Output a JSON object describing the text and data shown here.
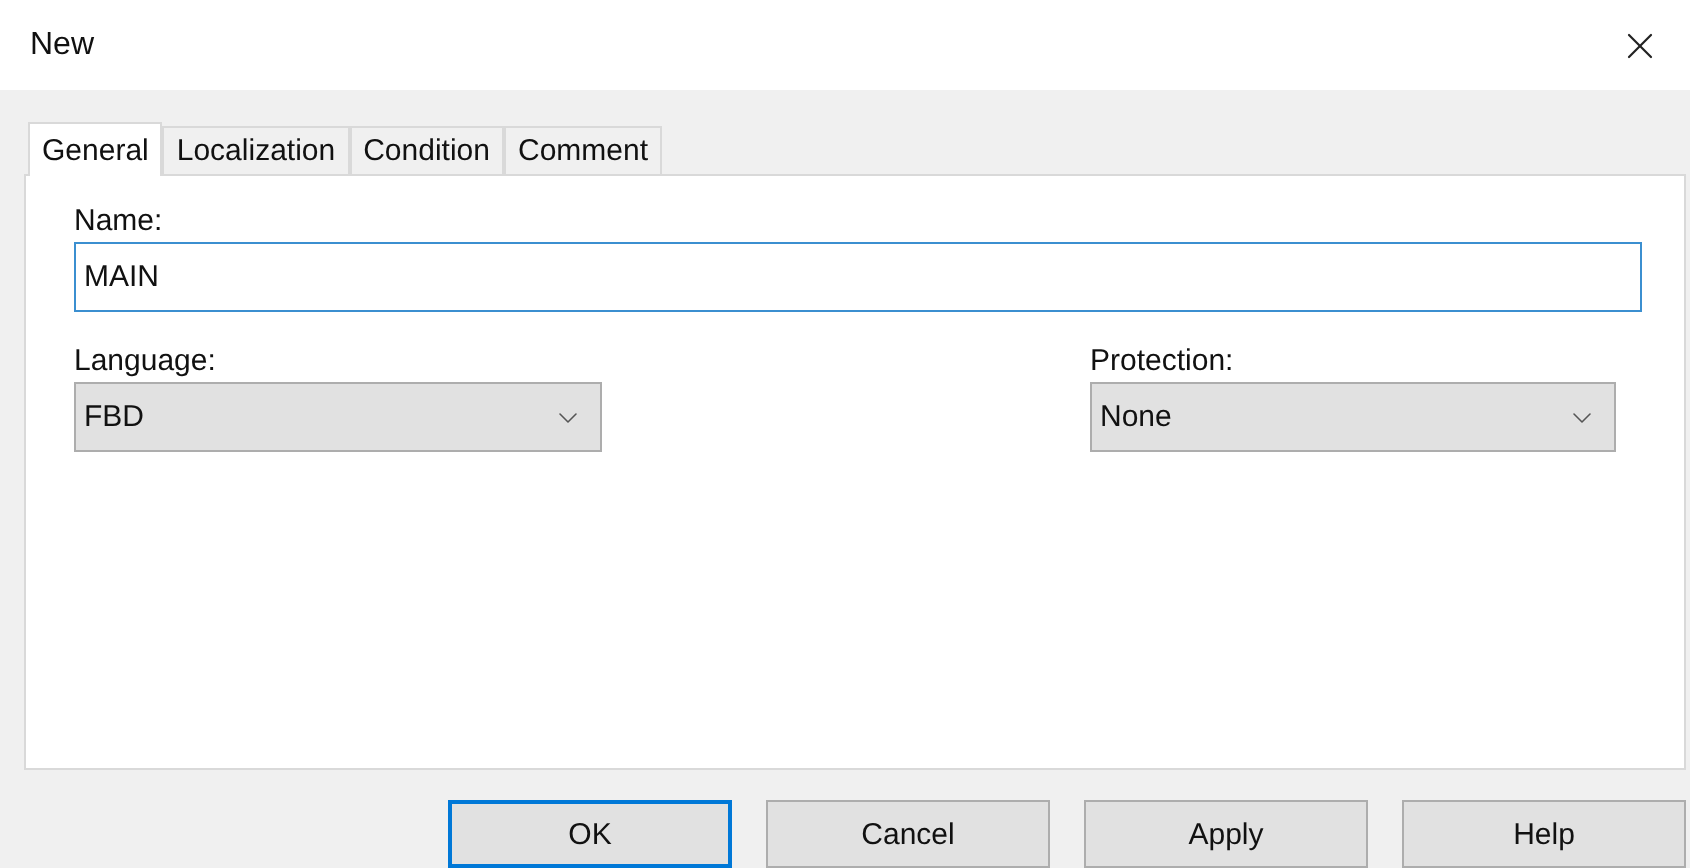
{
  "window": {
    "title": "New"
  },
  "tabs": [
    {
      "label": "General",
      "selected": true
    },
    {
      "label": "Localization",
      "selected": false
    },
    {
      "label": "Condition",
      "selected": false
    },
    {
      "label": "Comment",
      "selected": false
    }
  ],
  "name_field": {
    "label": "Name:",
    "value": "MAIN",
    "focused": true
  },
  "language": {
    "label": "Language:",
    "value": "FBD"
  },
  "protection": {
    "label": "Protection:",
    "value": "None"
  },
  "buttons": [
    {
      "label": "OK",
      "default": true
    },
    {
      "label": "Cancel",
      "default": false
    },
    {
      "label": "Apply",
      "default": false
    },
    {
      "label": "Help",
      "default": false
    }
  ]
}
